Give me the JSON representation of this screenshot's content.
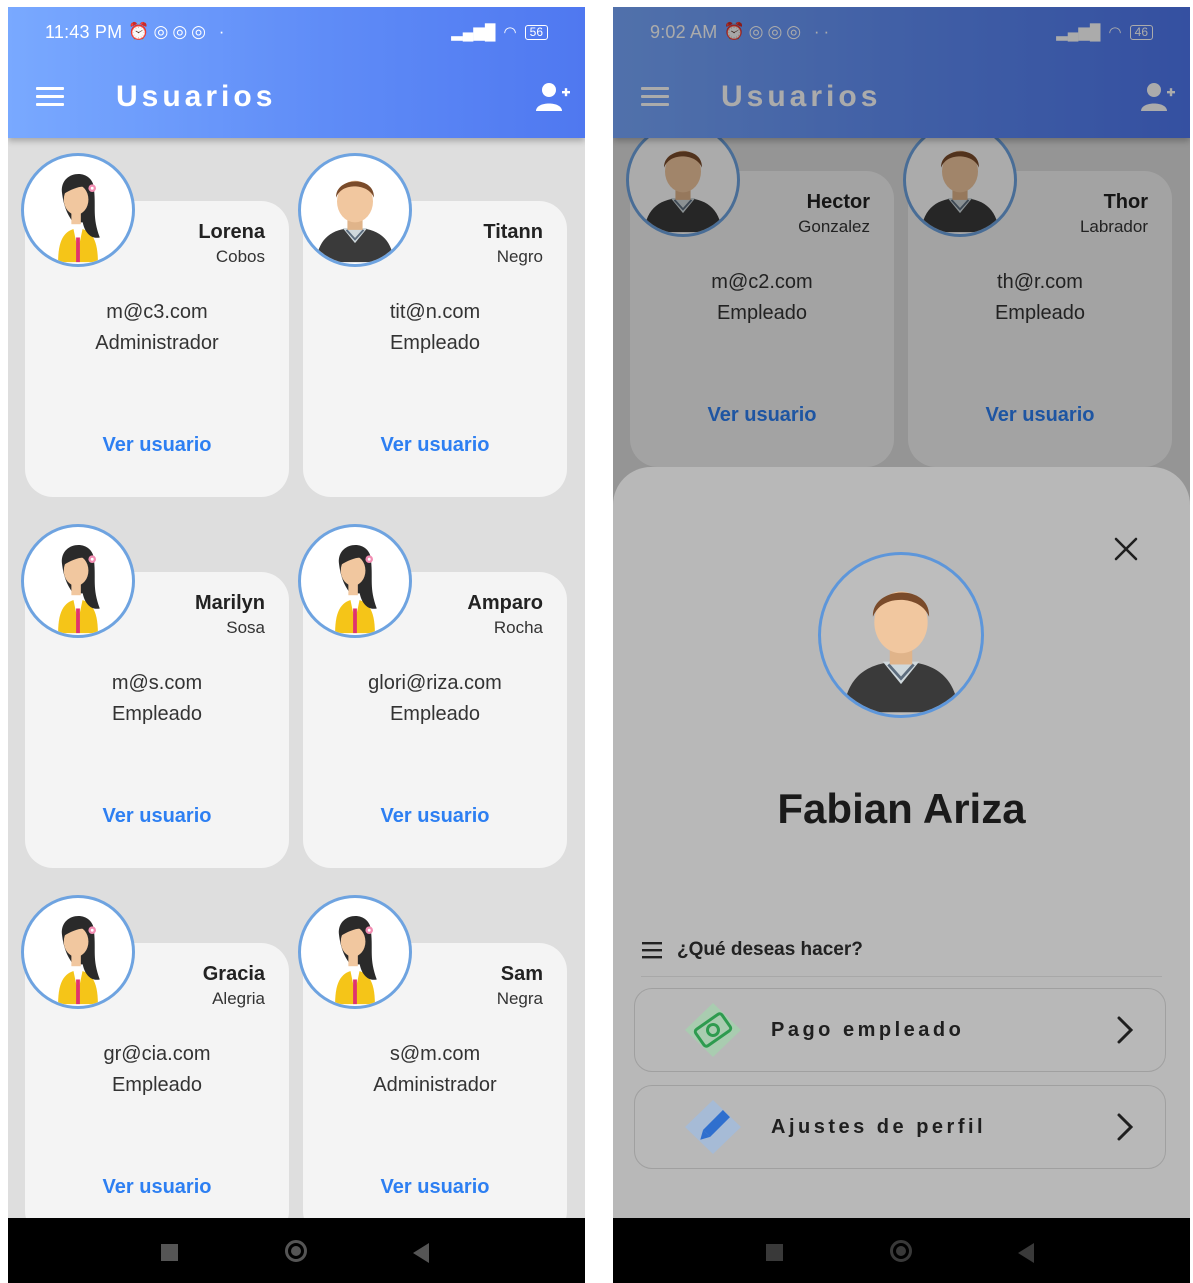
{
  "left": {
    "status": {
      "time": "11:43 PM",
      "battery": "56"
    },
    "appbar": {
      "title": "Usuarios"
    },
    "cards": [
      {
        "first": "Lorena",
        "last": "Cobos",
        "email": "m@c3.com",
        "role": "Administrador",
        "link": "Ver usuario",
        "avatar": "female-avatar-icon"
      },
      {
        "first": "Titann",
        "last": "Negro",
        "email": "tit@n.com",
        "role": "Empleado",
        "link": "Ver usuario",
        "avatar": "male-avatar-icon"
      },
      {
        "first": "Marilyn",
        "last": "Sosa",
        "email": "m@s.com",
        "role": "Empleado",
        "link": "Ver usuario",
        "avatar": "female-avatar-icon"
      },
      {
        "first": "Amparo",
        "last": "Rocha",
        "email": "glori@riza.com",
        "role": "Empleado",
        "link": "Ver usuario",
        "avatar": "female-avatar-icon"
      },
      {
        "first": "Gracia",
        "last": "Alegria",
        "email": "gr@cia.com",
        "role": "Empleado",
        "link": "Ver usuario",
        "avatar": "female-avatar-icon"
      },
      {
        "first": "Sam",
        "last": "Negra",
        "email": "s@m.com",
        "role": "Administrador",
        "link": "Ver usuario",
        "avatar": "female-avatar-icon"
      }
    ]
  },
  "right": {
    "status": {
      "time": "9:02 AM",
      "battery": "46"
    },
    "appbar": {
      "title": "Usuarios"
    },
    "cards": [
      {
        "first": "Hector",
        "last": "Gonzalez",
        "email": "m@c2.com",
        "role": "Empleado",
        "link": "Ver usuario",
        "avatar": "male-avatar-icon"
      },
      {
        "first": "Thor",
        "last": "Labrador",
        "email": "th@r.com",
        "role": "Empleado",
        "link": "Ver usuario",
        "avatar": "male-avatar-icon"
      }
    ],
    "sheet": {
      "name": "Fabian Ariza",
      "question": "¿Qué deseas hacer?",
      "actions": [
        {
          "label": "Pago empleado",
          "icon": "money-icon"
        },
        {
          "label": "Ajustes de perfil",
          "icon": "pencil-icon"
        }
      ]
    }
  },
  "colors": {
    "accent": "#2d7ff2",
    "appbar_start": "#79a9ff",
    "appbar_end": "#4f78f0",
    "avatar_ring": "#6ea3e0"
  }
}
